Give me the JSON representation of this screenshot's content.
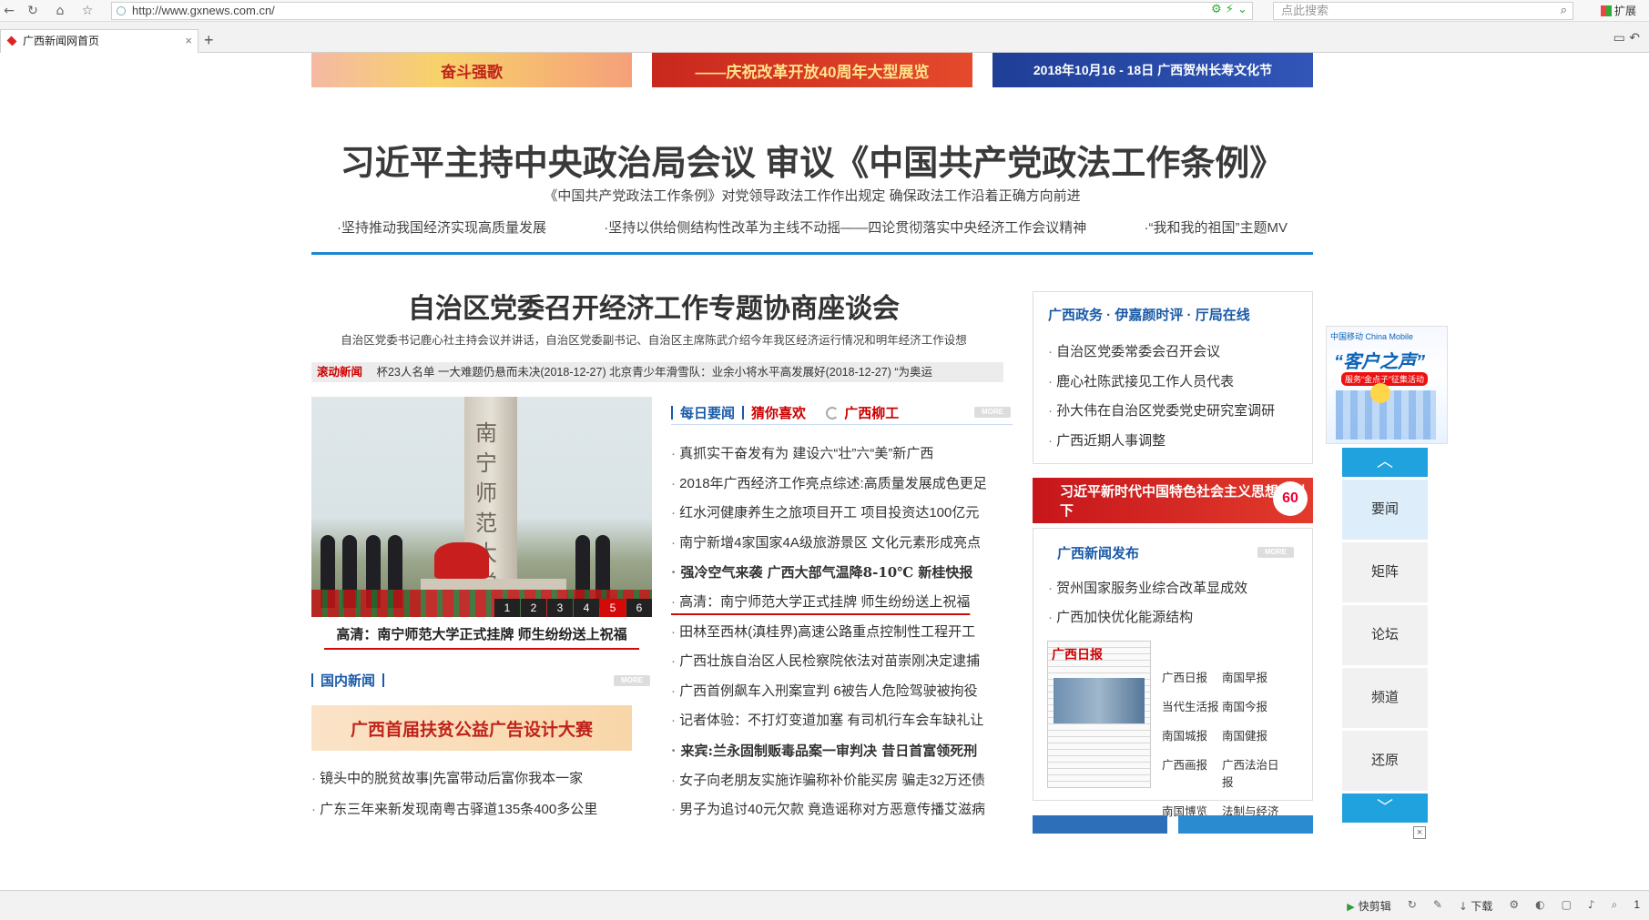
{
  "browser": {
    "url": "http://www.gxnews.com.cn/",
    "search_placeholder": "点此搜索",
    "extensions_label": "扩展",
    "tab_title": "广西新闻网首页",
    "tab_close": "×",
    "new_tab": "+",
    "nav_back_icon": "←",
    "nav_refresh_icon": "↻",
    "nav_home_icon": "⌂",
    "nav_star_icon": "☆",
    "search_icon": "⌕"
  },
  "banners": {
    "b1": "奋斗强歌",
    "b2": "——庆祝改革开放40周年大型展览",
    "b3": "2018年10月16 - 18日  广西贺州长寿文化节"
  },
  "headline": {
    "title": "习近平主持中央政治局会议 审议《中国共产党政法工作条例》",
    "sub": "《中国共产党政法工作条例》对党领导政法工作作出规定   确保政法工作沿着正确方向前进",
    "links": [
      "·坚持推动我国经济实现高质量发展",
      "·坚持以供给侧结构性改革为主线不动摇——四论贯彻落实中央经济工作会议精神",
      "·“我和我的祖国”主题MV"
    ]
  },
  "lead": {
    "title": "自治区党委召开经济工作专题协商座谈会",
    "sub": "自治区党委书记鹿心社主持会议并讲话，自治区党委副书记、自治区主席陈武介绍今年我区经济运行情况和明年经济工作设想"
  },
  "ticker": {
    "label": "滚动新闻",
    "text": "杯23人名单 一大难题仍悬而未决(2018-12-27)  北京青少年滑雪队：业余小将水平高发展好(2018-12-27)  “为奥运"
  },
  "photo": {
    "monument_text": "南宁师范大学",
    "pages": [
      "1",
      "2",
      "3",
      "4",
      "5",
      "6"
    ],
    "active_page": "5",
    "caption": "高清：南宁师范大学正式挂牌 师生纷纷送上祝福"
  },
  "center_news": {
    "tabs": [
      "每日要闻",
      "猜你喜欢",
      "广西柳工"
    ],
    "more": "MORE",
    "items": [
      {
        "text": "真抓实干奋发有为 建设六“壮”六“美”新广西",
        "bold": false
      },
      {
        "text": "2018年广西经济工作亮点综述:高质量发展成色更足",
        "bold": false
      },
      {
        "text": "红水河健康养生之旅项目开工 项目投资达100亿元",
        "bold": false
      },
      {
        "text": "南宁新增4家国家4A级旅游景区 文化元素形成亮点",
        "bold": false
      },
      {
        "text": "强冷空气来袭 广西大部气温降8-10℃ 新桂快报",
        "bold": true
      },
      {
        "text": "高清：南宁师范大学正式挂牌 师生纷纷送上祝福",
        "bold": false
      },
      {
        "text": "田林至西林(滇桂界)高速公路重点控制性工程开工",
        "bold": false
      },
      {
        "text": "广西壮族自治区人民检察院依法对苗崇刚决定逮捕",
        "bold": false
      },
      {
        "text": "广西首例飙车入刑案宣判 6被告人危险驾驶被拘役",
        "bold": false
      },
      {
        "text": "记者体验：不打灯变道加塞 有司机行车会车缺礼让",
        "bold": false
      },
      {
        "text": "来宾:兰永固制贩毒品案一审判决 昔日首富领死刑",
        "bold": true
      },
      {
        "text": "女子向老朋友实施诈骗称补价能买房 骗走32万还债",
        "bold": false
      },
      {
        "text": "男子为追讨40元欠款 竟造谣称对方恶意传播艾滋病",
        "bold": false
      }
    ]
  },
  "domestic": {
    "title": "国内新闻",
    "more": "MORE",
    "ad": "广西首届扶贫公益广告设计大赛",
    "items": [
      "镜头中的脱贫故事|先富带动后富你我本一家",
      "广东三年来新发现南粤古驿道135条400多公里"
    ]
  },
  "gov": {
    "tabs": [
      "广西政务",
      "伊嘉颜时评",
      "厅局在线"
    ],
    "items": [
      "自治区党委常委会召开会议",
      "鹿心社陈武接见工作人员代表",
      "孙大伟在自治区党委党史研究室调研",
      "广西近期人事调整"
    ]
  },
  "side_ad": {
    "text": "习近平新时代中国特色社会主义思想指引下",
    "badge": "60"
  },
  "release": {
    "title": "广西新闻发布",
    "more": "MORE",
    "items": [
      "贺州国家服务业综合改革显成效",
      "广西加快优化能源结构"
    ],
    "paper_mast": "广西日报",
    "papers": [
      "广西日报",
      "南国早报",
      "当代生活报",
      "南国今报",
      "南国城报",
      "南国健报",
      "广西画报",
      "广西法治日报",
      "南国博览",
      "法制与经济"
    ]
  },
  "float_ad": {
    "logo": "中国移动 China Mobile",
    "slogan": "“客户之声”",
    "tag": "服务“金点子”征集活动"
  },
  "side_nav": {
    "up": "︿",
    "items": [
      "要闻",
      "矩阵",
      "论坛",
      "频道",
      "还原"
    ],
    "down": "﹀",
    "close": "×"
  },
  "status": {
    "kuaijianji": "快剪辑",
    "download": "下载",
    "zoom": "1"
  },
  "colors": {
    "accent_blue": "#1e88cf",
    "headline_red": "#d20a0a",
    "link_blue": "#1a5aa8",
    "nav_blue": "#1fa2de"
  }
}
